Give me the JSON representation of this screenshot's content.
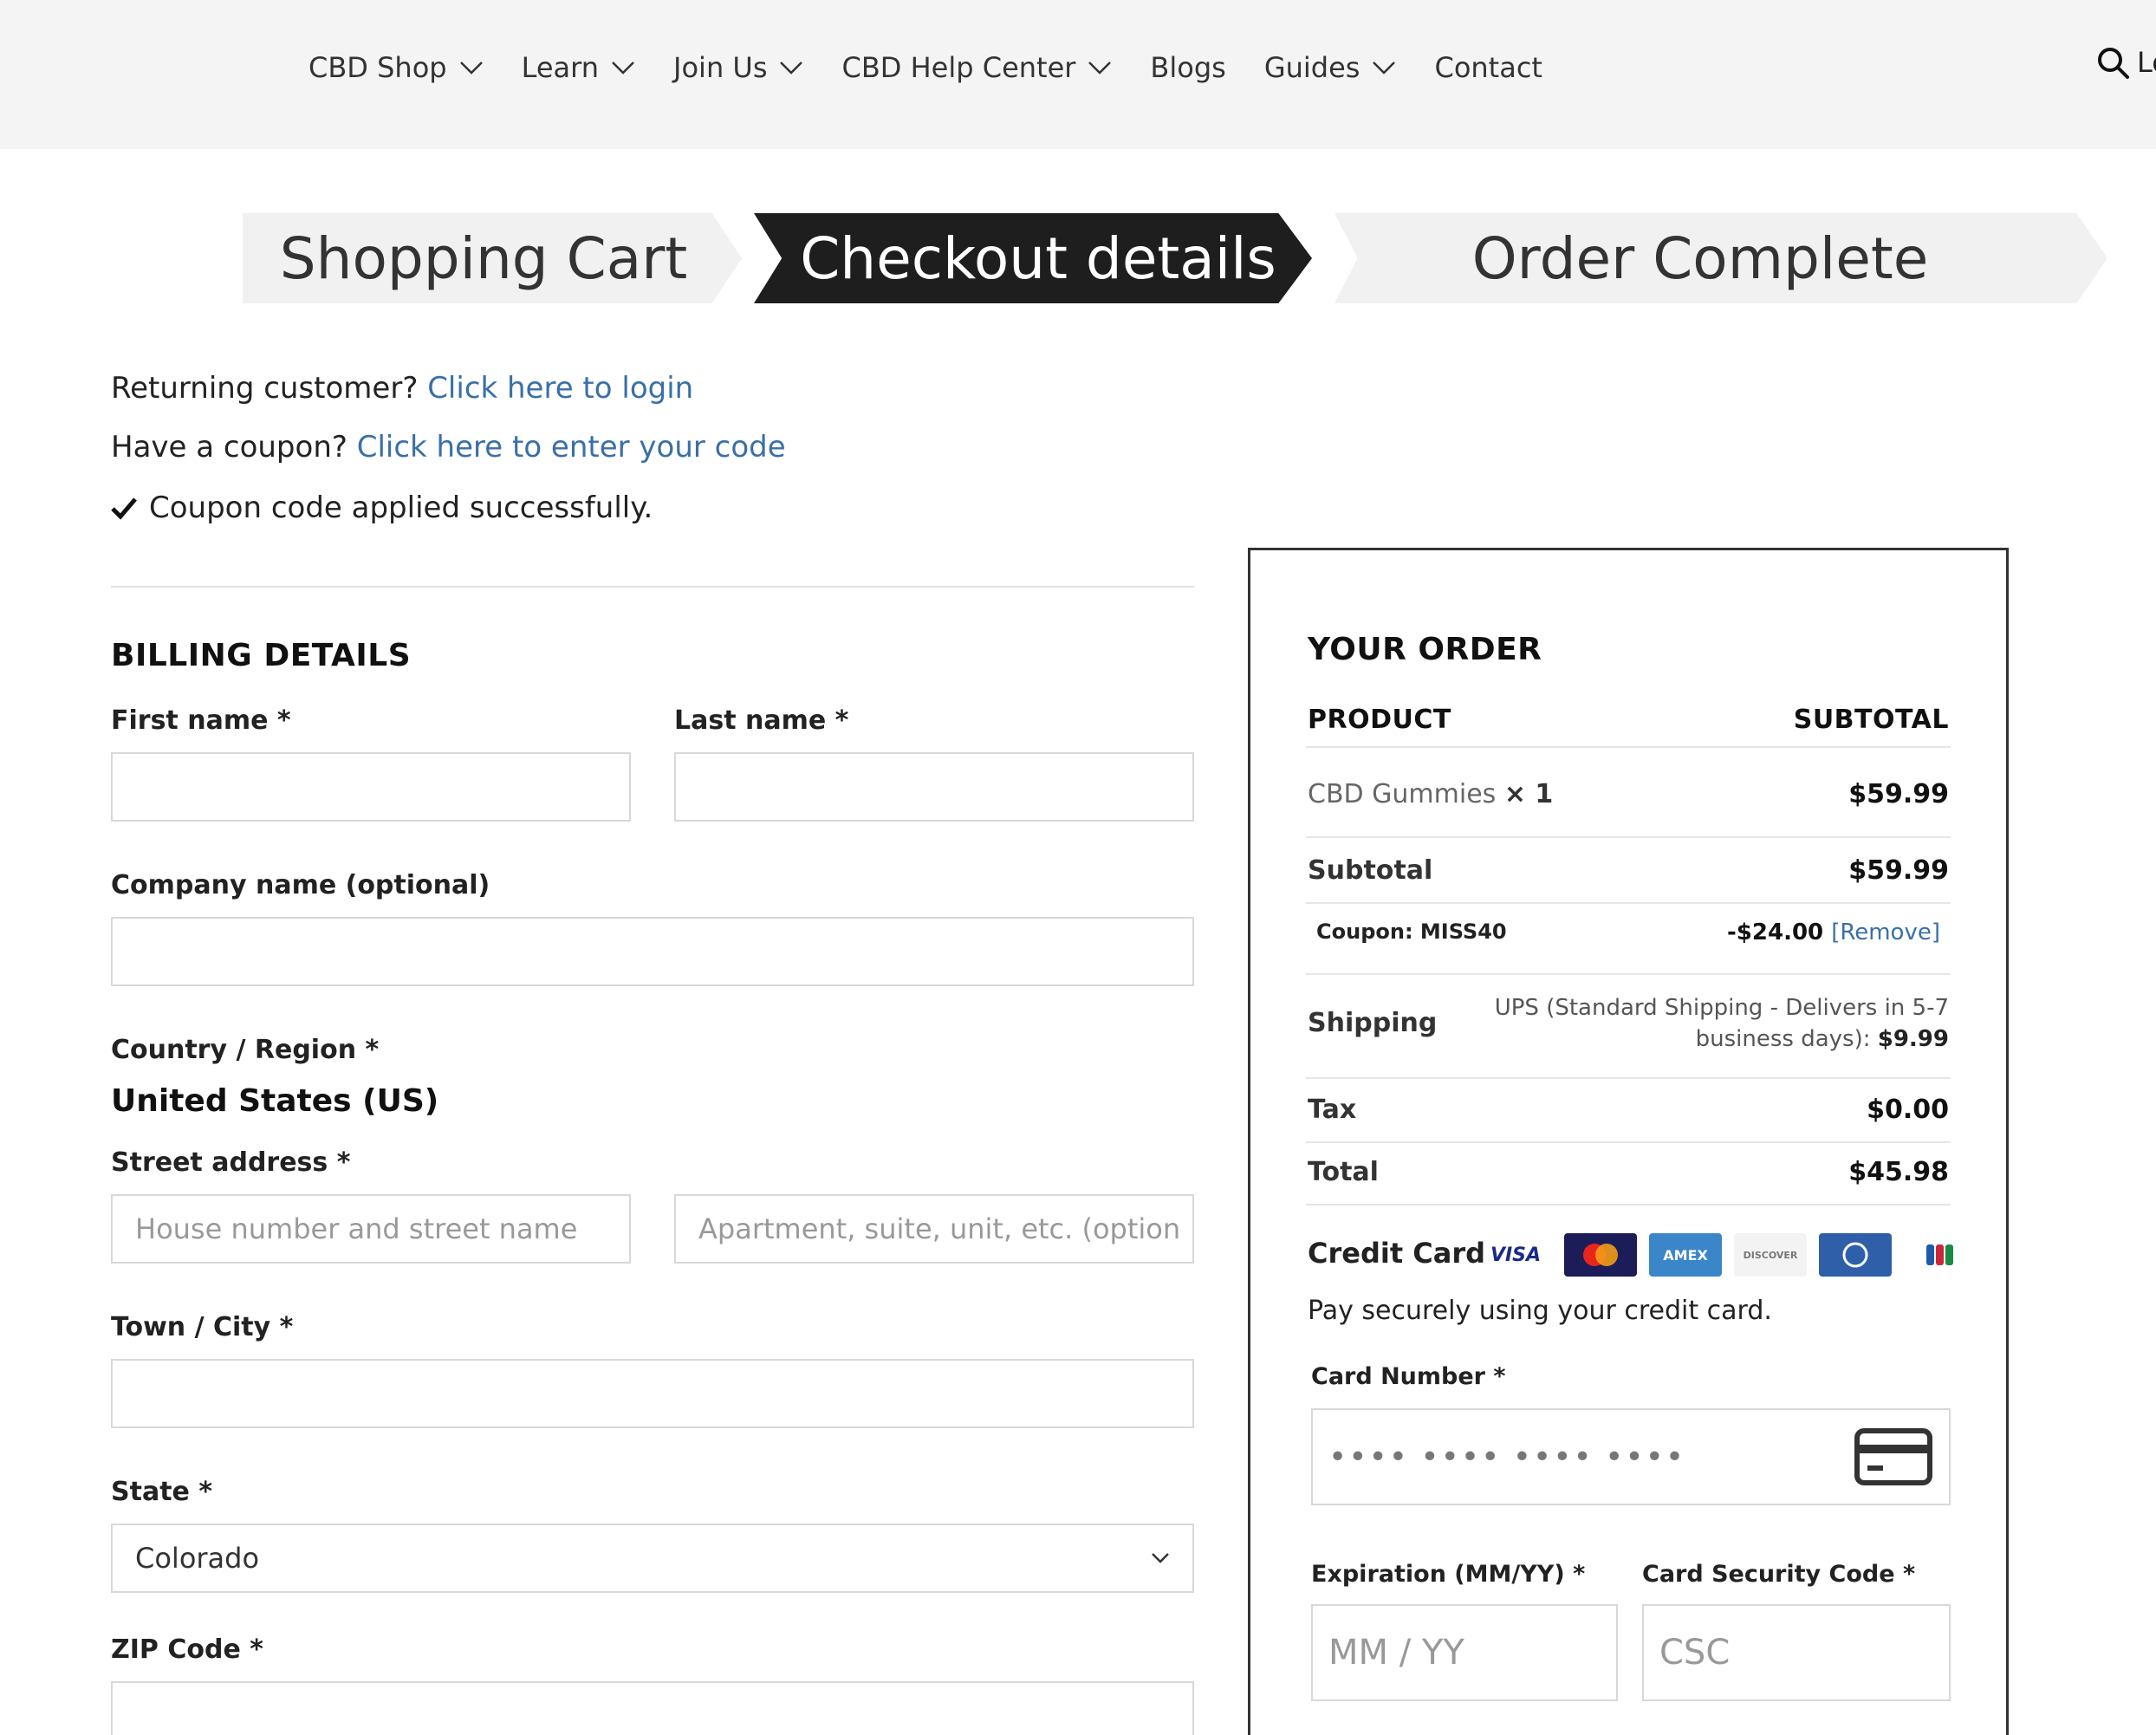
{
  "nav": {
    "items": [
      {
        "label": "CBD Shop",
        "dropdown": true
      },
      {
        "label": "Learn",
        "dropdown": true
      },
      {
        "label": "Join Us",
        "dropdown": true
      },
      {
        "label": "CBD Help Center",
        "dropdown": true
      },
      {
        "label": "Blogs",
        "dropdown": false
      },
      {
        "label": "Guides",
        "dropdown": true
      },
      {
        "label": "Contact",
        "dropdown": false
      }
    ],
    "search_icon": "search-icon",
    "account_partial": "Lo"
  },
  "steps": {
    "step1": "Shopping Cart",
    "step2": "Checkout details",
    "step3": "Order Complete",
    "active": "Checkout details"
  },
  "notices": {
    "returning_text": "Returning customer?",
    "returning_link": "Click here to login",
    "coupon_text": "Have a coupon?",
    "coupon_link": "Click here to enter your code",
    "applied": "Coupon code applied successfully."
  },
  "billing": {
    "title": "BILLING DETAILS",
    "first_name_label": "First name *",
    "last_name_label": "Last name *",
    "company_label": "Company name (optional)",
    "country_label": "Country / Region *",
    "country_value": "United States (US)",
    "street_label": "Street address *",
    "street_placeholder": "House number and street name",
    "apt_placeholder": "Apartment, suite, unit, etc. (option",
    "city_label": "Town / City *",
    "state_label": "State *",
    "state_value": "Colorado",
    "zip_label": "ZIP Code *"
  },
  "order": {
    "title": "YOUR ORDER",
    "col_product": "PRODUCT",
    "col_subtotal": "SUBTOTAL",
    "product_name": "CBD Gummies",
    "product_qty": "× 1",
    "product_price": "$59.99",
    "subtotal_label": "Subtotal",
    "subtotal_value": "$59.99",
    "coupon_label": "Coupon: MISS40",
    "coupon_value": "-$24.00",
    "coupon_remove": "[Remove]",
    "shipping_label": "Shipping",
    "shipping_line1": "UPS (Standard Shipping - Delivers in 5-7",
    "shipping_line2": "business days):",
    "shipping_price": "$9.99",
    "tax_label": "Tax",
    "tax_value": "$0.00",
    "total_label": "Total",
    "total_value": "$45.98"
  },
  "payment": {
    "method_label": "Credit Card",
    "cards": [
      "VISA",
      "mastercard",
      "amex",
      "discover",
      "diners",
      "JCB"
    ],
    "description": "Pay securely using your credit card.",
    "card_number_label": "Card Number *",
    "card_number_placeholder": "•••• •••• •••• ••••",
    "expiry_label": "Expiration (MM/YY) *",
    "expiry_placeholder": "MM / YY",
    "csc_label": "Card Security Code *",
    "csc_placeholder": "CSC"
  },
  "colors": {
    "link": "#3a6fa8",
    "active_step_bg": "#1e1e1e",
    "inactive_step_bg": "#f1f1f1"
  }
}
